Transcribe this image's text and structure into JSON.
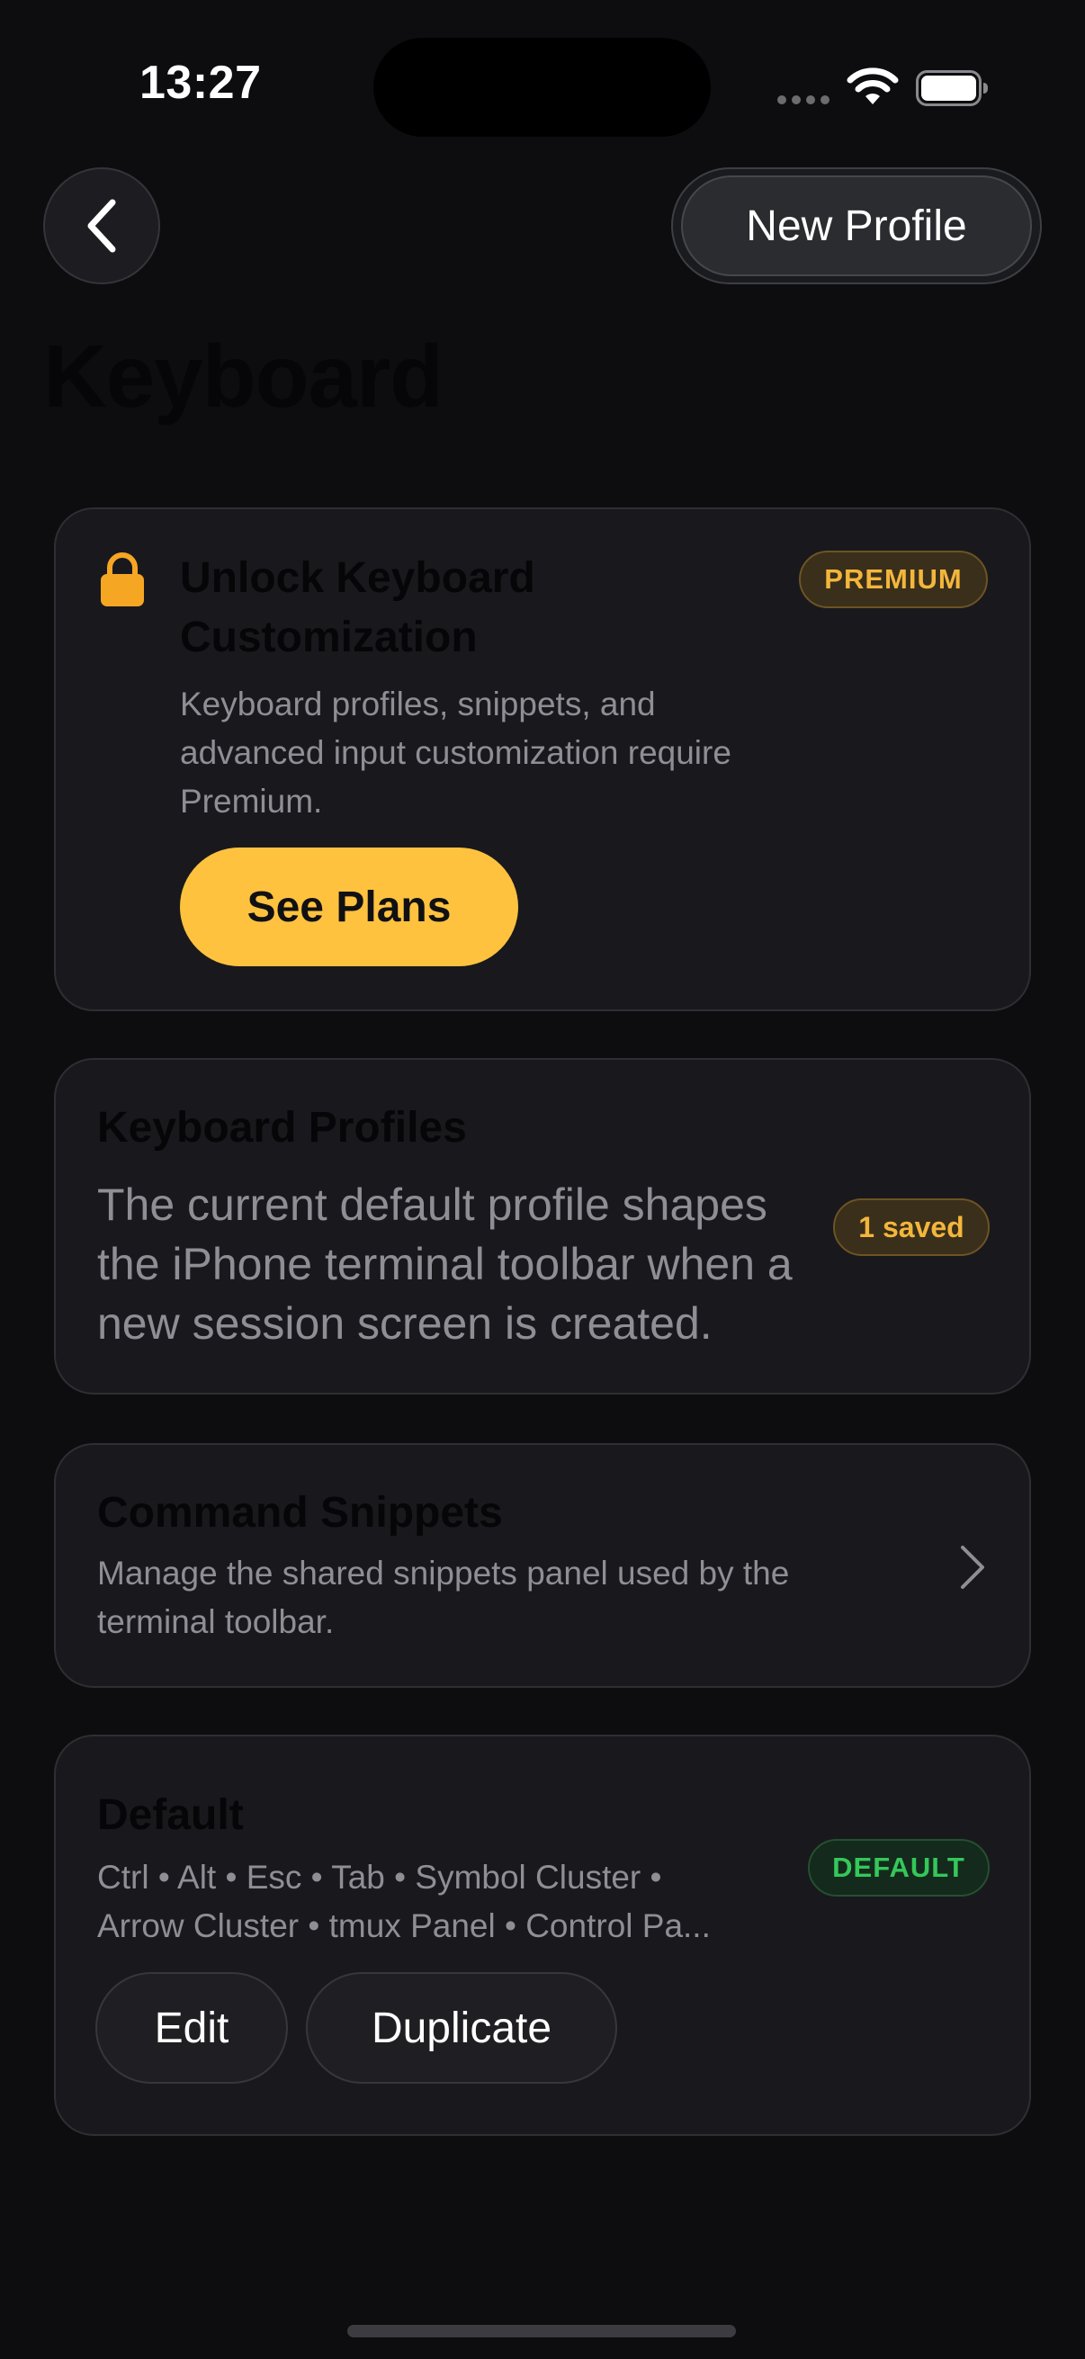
{
  "status_bar": {
    "time": "13:27"
  },
  "header": {
    "back_icon": "chevron-left-icon",
    "new_profile_label": "New Profile",
    "title": "Keyboard"
  },
  "premium_card": {
    "icon": "lock-icon",
    "title": "Unlock Keyboard Customization",
    "badge": "PREMIUM",
    "description": "Keyboard profiles, snippets, and advanced input customization require Premium.",
    "cta_label": "See Plans"
  },
  "profiles_card": {
    "title": "Keyboard Profiles",
    "description": "The current default profile shapes the iPhone terminal toolbar when a new session screen is created.",
    "badge": "1 saved"
  },
  "snippets_card": {
    "title": "Command Snippets",
    "description": "Manage the shared snippets panel used by the terminal toolbar.",
    "icon": "chevron-right-icon"
  },
  "default_profile_card": {
    "title": "Default",
    "keys_line_1": "Ctrl • Alt • Esc • Tab • Symbol Cluster •",
    "keys_line_2": "Arrow Cluster • tmux Panel • Control Pa...",
    "badge": "DEFAULT",
    "edit_label": "Edit",
    "duplicate_label": "Duplicate"
  },
  "colors": {
    "background": "#0d0d10",
    "card": "#19191d",
    "accent_amber": "#ffc23f",
    "premium_badge_text": "#f3b63c",
    "default_badge_text": "#35c75a"
  }
}
